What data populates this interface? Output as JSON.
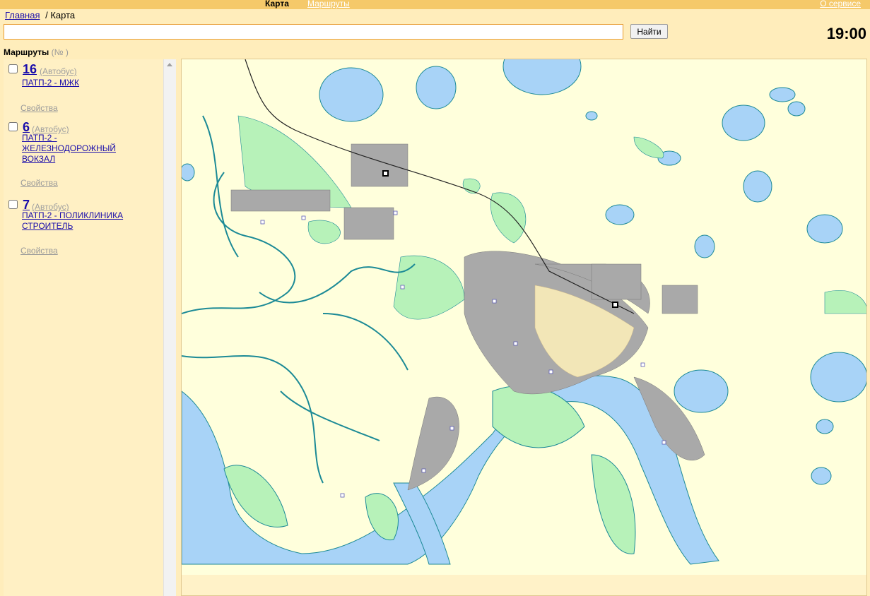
{
  "topbar": {
    "map_tab": "Карта",
    "routes_tab": "Маршруты",
    "about": "О сервисе"
  },
  "breadcrumb": {
    "home": "Главная",
    "separator": "/",
    "current": "Карта"
  },
  "search": {
    "value": "",
    "placeholder": "",
    "button": "Найти"
  },
  "clock": "19:00",
  "routes_panel": {
    "title": "Маршруты",
    "number_hint": "(№ )",
    "routes": [
      {
        "number": "16",
        "type": "(Автобус)",
        "name_lines": [
          "ПАТП-2 - МЖК"
        ],
        "properties": "Свойства",
        "checked": false
      },
      {
        "number": "6",
        "type": "(Автобус)",
        "name_lines": [
          "ПАТП-2 -",
          "ЖЕЛЕЗНОДОРОЖНЫЙ",
          "ВОКЗАЛ"
        ],
        "properties": "Свойства",
        "checked": false
      },
      {
        "number": "7",
        "type": "(Автобус)",
        "name_lines": [
          "ПАТП-2 - ПОЛИКЛИНИКА",
          "СТРОИТЕЛЬ"
        ],
        "properties": "Свойства",
        "checked": false
      }
    ]
  },
  "map": {
    "colors": {
      "land": "#ffffdc",
      "water": "#a8d3f7",
      "water_edge": "#1c8a96",
      "park": "#b7f2b9",
      "urban": "#a9a9a9",
      "urban_light": "#f2e6b7",
      "rail": "#222222",
      "road": "#ffffff"
    },
    "icons": [
      "bus-stop-icon",
      "railway-station-icon"
    ]
  }
}
